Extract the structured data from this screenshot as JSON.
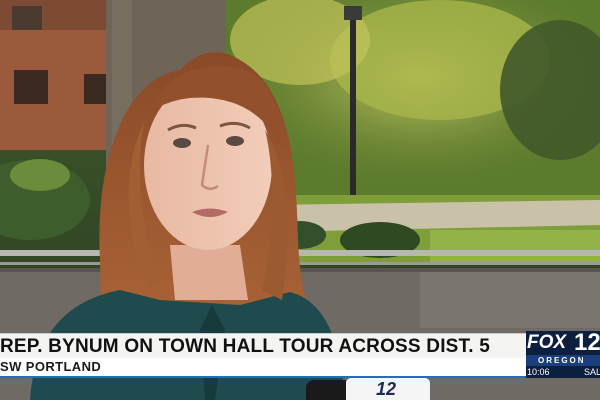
{
  "chyron": {
    "headline": "REP. BYNUM ON TOWN HALL TOUR ACROSS DIST. 5",
    "subline": "SW PORTLAND",
    "accent_color": "#1c6fc4"
  },
  "station_bug": {
    "network": "FOX",
    "channel": "12",
    "region": "OREGON",
    "time": "10:06",
    "weather_partial": "SAL"
  },
  "microphone": {
    "label": "12"
  }
}
